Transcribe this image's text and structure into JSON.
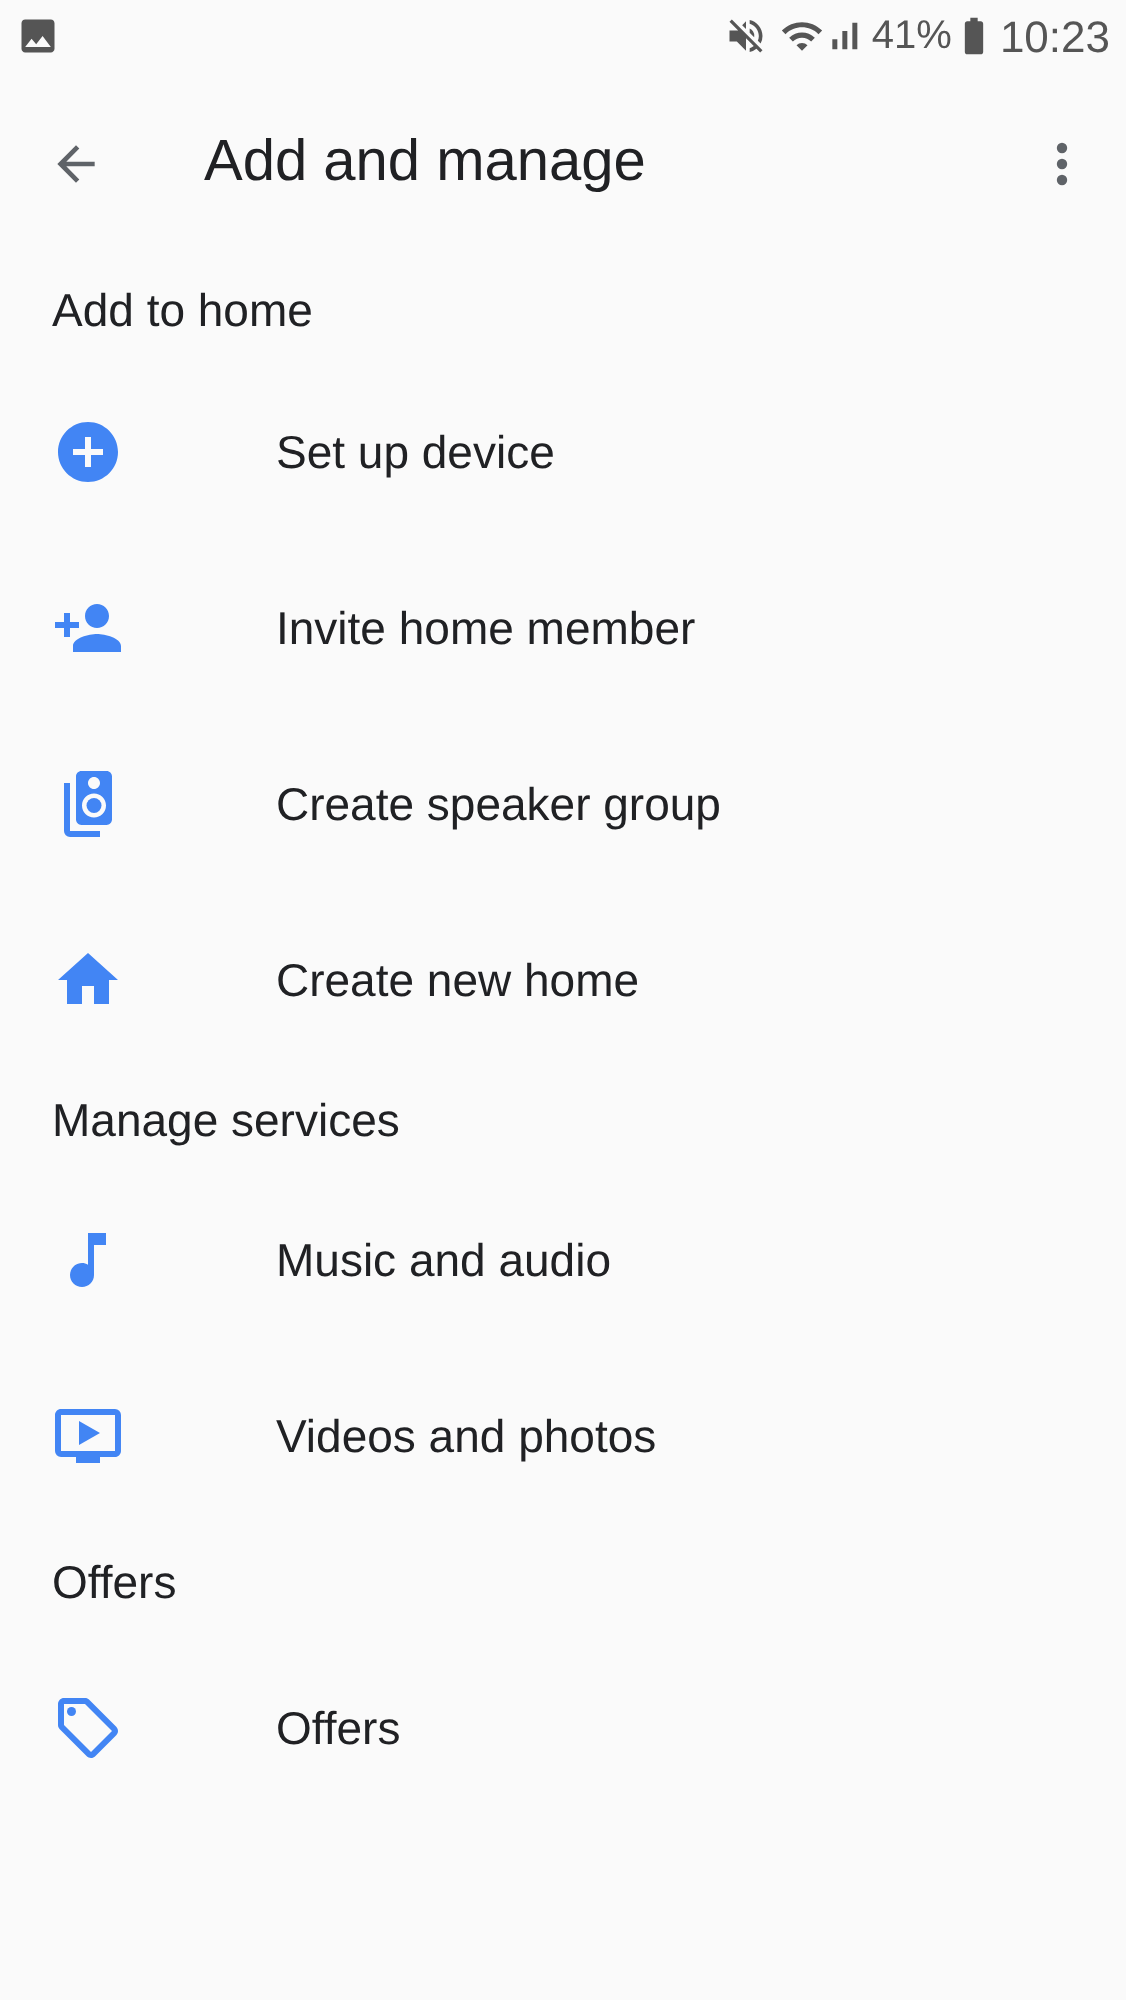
{
  "status_bar": {
    "battery": "41%",
    "time": "10:23"
  },
  "app_bar": {
    "title": "Add and manage"
  },
  "sections": [
    {
      "title": "Add to home",
      "items": [
        {
          "kind": "add",
          "label": "Set up device"
        },
        {
          "kind": "invite",
          "label": "Invite home member"
        },
        {
          "kind": "speaker",
          "label": "Create speaker group"
        },
        {
          "kind": "home",
          "label": "Create new home"
        }
      ]
    },
    {
      "title": "Manage services",
      "items": [
        {
          "kind": "music",
          "label": "Music and audio"
        },
        {
          "kind": "video",
          "label": "Videos and photos"
        }
      ]
    },
    {
      "title": "Offers",
      "items": [
        {
          "kind": "offer",
          "label": "Offers"
        }
      ]
    }
  ]
}
